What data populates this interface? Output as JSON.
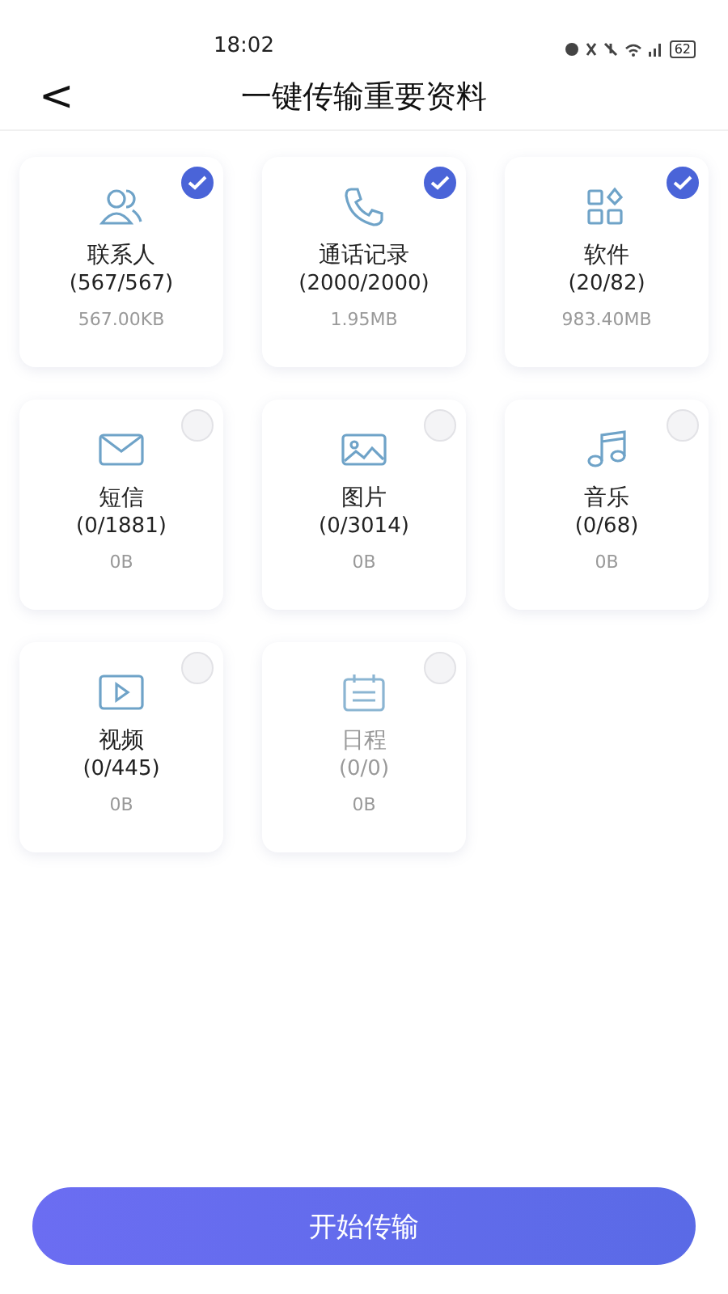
{
  "status_bar": {
    "time": "18:02",
    "battery": "62"
  },
  "header": {
    "back": "<",
    "title": "一键传输重要资料"
  },
  "items": [
    {
      "kind": "contacts",
      "name": "联系人",
      "count": "(567/567)",
      "size": "567.00KB",
      "checked": true,
      "disabled": false
    },
    {
      "kind": "phone",
      "name": "通话记录",
      "count": "(2000/2000)",
      "size": "1.95MB",
      "checked": true,
      "disabled": false
    },
    {
      "kind": "apps",
      "name": "软件",
      "count": "(20/82)",
      "size": "983.40MB",
      "checked": true,
      "disabled": false
    },
    {
      "kind": "mail",
      "name": "短信",
      "count": "(0/1881)",
      "size": "0B",
      "checked": false,
      "disabled": false
    },
    {
      "kind": "image",
      "name": "图片",
      "count": "(0/3014)",
      "size": "0B",
      "checked": false,
      "disabled": false
    },
    {
      "kind": "music",
      "name": "音乐",
      "count": "(0/68)",
      "size": "0B",
      "checked": false,
      "disabled": false
    },
    {
      "kind": "video",
      "name": "视频",
      "count": "(0/445)",
      "size": "0B",
      "checked": false,
      "disabled": false
    },
    {
      "kind": "calendar",
      "name": "日程",
      "count": "(0/0)",
      "size": "0B",
      "checked": false,
      "disabled": true
    }
  ],
  "start_button": "开始传输"
}
